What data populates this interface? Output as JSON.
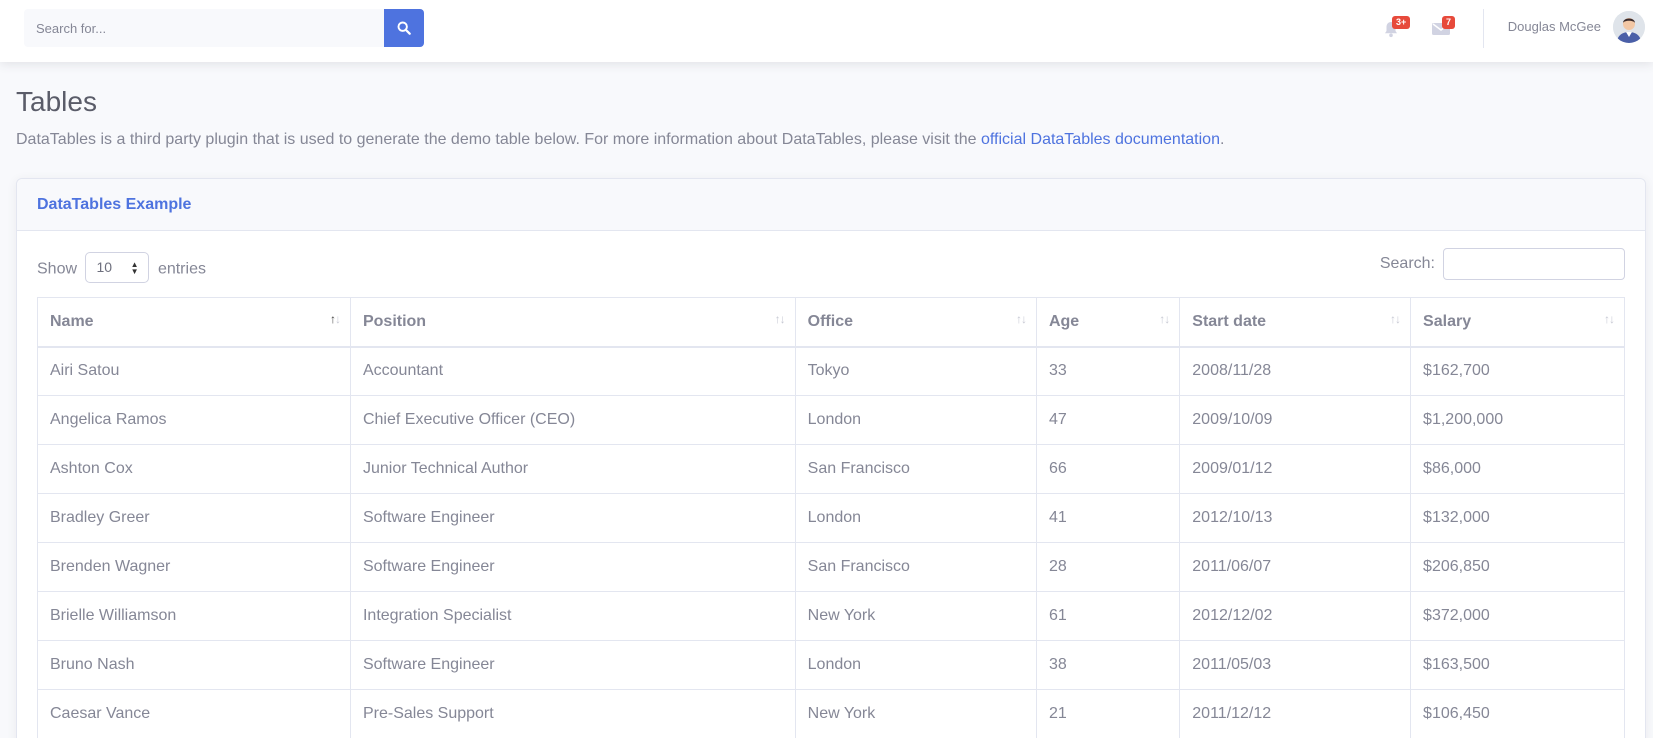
{
  "topbar": {
    "search_placeholder": "Search for...",
    "alerts_badge": "3+",
    "messages_badge": "7",
    "user_name": "Douglas McGee"
  },
  "page": {
    "title": "Tables",
    "description_prefix": "DataTables is a third party plugin that is used to generate the demo table below. For more information about DataTables, please visit the ",
    "description_link": "official DataTables documentation",
    "description_suffix": "."
  },
  "card": {
    "title": "DataTables Example",
    "show_label": "Show",
    "entries_label": "entries",
    "length_value": "10",
    "search_label": "Search:"
  },
  "table": {
    "columns": [
      "Name",
      "Position",
      "Office",
      "Age",
      "Start date",
      "Salary"
    ],
    "rows": [
      [
        "Airi Satou",
        "Accountant",
        "Tokyo",
        "33",
        "2008/11/28",
        "$162,700"
      ],
      [
        "Angelica Ramos",
        "Chief Executive Officer (CEO)",
        "London",
        "47",
        "2009/10/09",
        "$1,200,000"
      ],
      [
        "Ashton Cox",
        "Junior Technical Author",
        "San Francisco",
        "66",
        "2009/01/12",
        "$86,000"
      ],
      [
        "Bradley Greer",
        "Software Engineer",
        "London",
        "41",
        "2012/10/13",
        "$132,000"
      ],
      [
        "Brenden Wagner",
        "Software Engineer",
        "San Francisco",
        "28",
        "2011/06/07",
        "$206,850"
      ],
      [
        "Brielle Williamson",
        "Integration Specialist",
        "New York",
        "61",
        "2012/12/02",
        "$372,000"
      ],
      [
        "Bruno Nash",
        "Software Engineer",
        "London",
        "38",
        "2011/05/03",
        "$163,500"
      ],
      [
        "Caesar Vance",
        "Pre-Sales Support",
        "New York",
        "21",
        "2011/12/12",
        "$106,450"
      ]
    ]
  },
  "colors": {
    "primary": "#4e73df",
    "danger": "#e74a3b",
    "text": "#858796",
    "heading": "#5a5c69"
  }
}
